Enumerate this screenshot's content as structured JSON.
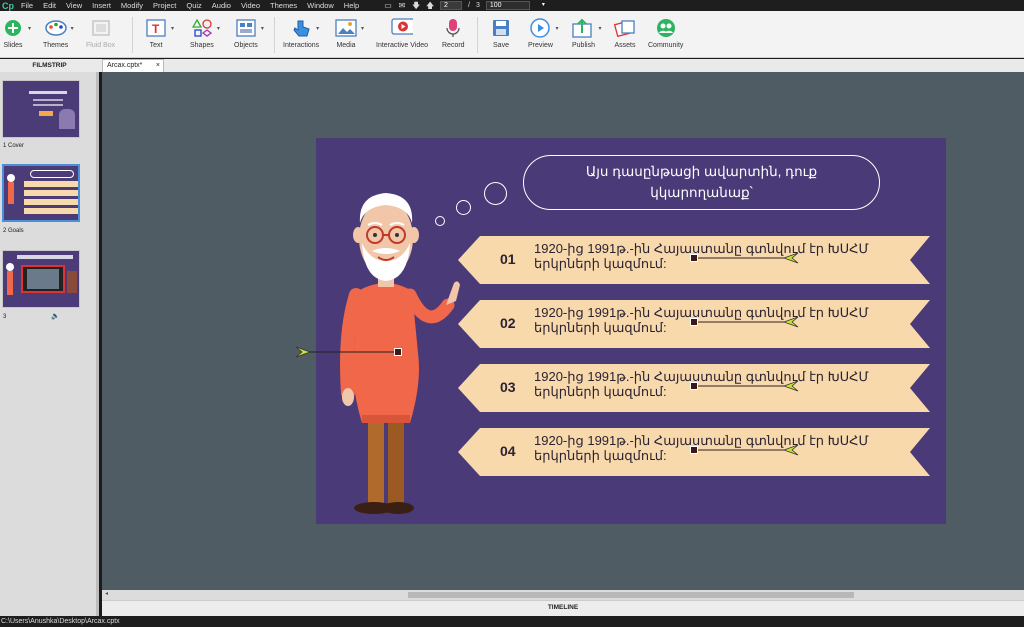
{
  "menubar": {
    "logo": "Cp",
    "items": [
      "File",
      "Edit",
      "View",
      "Insert",
      "Modify",
      "Project",
      "Quiz",
      "Audio",
      "Video",
      "Themes",
      "Window",
      "Help"
    ],
    "current_page": "2",
    "page_separator": "/",
    "total_pages": "3",
    "zoom": "100"
  },
  "toolbar": {
    "slides": "Slides",
    "themes": "Themes",
    "fluid_box": "Fluid Box",
    "text": "Text",
    "shapes": "Shapes",
    "objects": "Objects",
    "interactions": "Interactions",
    "media": "Media",
    "interactive_video": "Interactive Video",
    "record": "Record",
    "save": "Save",
    "preview": "Preview",
    "publish": "Publish",
    "assets": "Assets",
    "community": "Community"
  },
  "filmstrip": {
    "header": "FILMSTRIP",
    "slides": [
      {
        "caption": "1 Cover"
      },
      {
        "caption": "2 Goals"
      },
      {
        "caption": "3"
      }
    ]
  },
  "document_tab": {
    "title": "Arcax.cptx*",
    "close": "×"
  },
  "slide": {
    "bubble_text_line1": "Այս դասընթացի ավարտին, դուք",
    "bubble_text_line2": "կկարողանաք՝",
    "goals": [
      {
        "num": "01",
        "line1": "1920-ից 1991թ.-ին Հայաստանը գտնվում էր ԽՍՀՄ",
        "line2": "երկրների կազմում:"
      },
      {
        "num": "02",
        "line1": "1920-ից 1991թ.-ին Հայաստանը գտնվում էր ԽՍՀՄ",
        "line2": "երկրների կազմում:"
      },
      {
        "num": "03",
        "line1": "1920-ից 1991թ.-ին Հայաստանը գտնվում էր ԽՍՀՄ",
        "line2": "երկրների կազմում:"
      },
      {
        "num": "04",
        "line1": "1920-ից 1991թ.-ին Հայաստանը գտնվում էր ԽՍՀՄ",
        "line2": "երկրների կազմում:"
      }
    ]
  },
  "timeline_label": "TIMELINE",
  "status_path": "C:\\Users\\Anushka\\Desktop\\Arcax.cptx",
  "colors": {
    "slide_bg": "#4a3a78",
    "band": "#f8d9ac",
    "stage": "#4f5c63"
  }
}
